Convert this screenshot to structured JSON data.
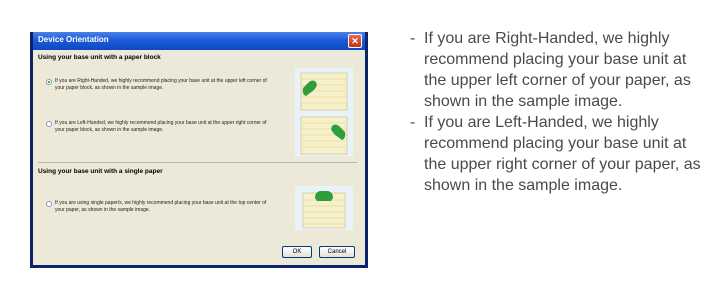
{
  "dialog": {
    "title": "Device Orientation",
    "section_paper_block": "Using your base unit with a paper block",
    "section_single_paper": "Using your base unit with a single paper",
    "options": [
      {
        "text": "If you are Right-Handed, we highly recommend placing your base unit at the upper left corner of your paper block, as shown in the sample image.",
        "selected": true
      },
      {
        "text": "If you are Left-Handed, we highly recommend placing your base unit at the upper right corner of your paper block, as shown in the sample image.",
        "selected": false
      },
      {
        "text": "If you are using single paper/s, we highly recommend placing your base unit at the top center of your paper, as shown in the sample image.",
        "selected": false
      }
    ],
    "ok_label": "OK",
    "cancel_label": "Cancel"
  },
  "description": [
    {
      "dash": "-",
      "text": "If you are Right-Handed, we highly recommend placing your base unit at the upper left corner of your paper, as shown in the sample image."
    },
    {
      "dash": "-",
      "text": "If you are Left-Handed, we highly recommend placing your base unit at the upper right corner of your paper, as shown in the sample image."
    }
  ],
  "colors": {
    "paper": "#f7f1c9",
    "paper_line": "#d9cf98",
    "device": "#2e9e3a",
    "sample_bg": "#e9f2f9"
  }
}
